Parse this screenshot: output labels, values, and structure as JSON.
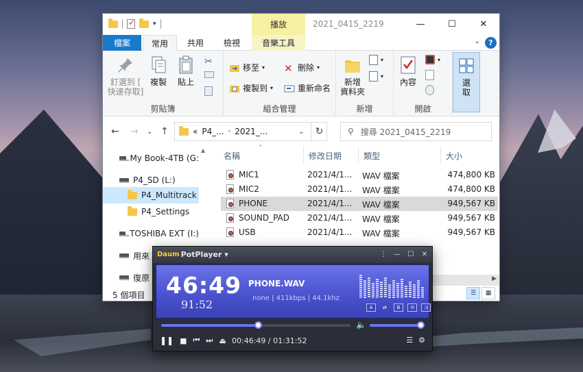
{
  "explorer": {
    "qat": {
      "dropdown_icon": "▾"
    },
    "contextual_tab": "播放",
    "title": "2021_0415_2219",
    "tabs": {
      "file": "檔案",
      "home": "常用",
      "share": "共用",
      "view": "檢視",
      "music": "音樂工具"
    },
    "ribbon": {
      "clipboard": {
        "label": "剪貼簿",
        "pin": "釘選到 [\n快速存取]",
        "copy": "複製",
        "paste": "貼上"
      },
      "organize": {
        "label": "組合管理",
        "move_to": "移至",
        "copy_to": "複製到",
        "delete": "刪除",
        "rename": "重新命名"
      },
      "new": {
        "label": "新增",
        "new_folder": "新增\n資料夾"
      },
      "open": {
        "label": "開啟",
        "properties": "內容"
      },
      "select": {
        "select": "選\n取"
      }
    },
    "address": {
      "prefix": "«",
      "part1": "P4_...",
      "part2": "2021_...",
      "search_placeholder": "搜尋 2021_0415_2219"
    },
    "nav": [
      {
        "label": "My Book-4TB (G:",
        "type": "drive"
      },
      {
        "label": "P4_SD (L:)",
        "type": "drive"
      },
      {
        "label": "P4_Multitrack",
        "type": "folder",
        "selected": true
      },
      {
        "label": "P4_Settings",
        "type": "folder"
      },
      {
        "label": "TOSHIBA EXT (I:)",
        "type": "drive"
      },
      {
        "label": "用來",
        "type": "drive"
      },
      {
        "label": "復原",
        "type": "drive"
      }
    ],
    "columns": {
      "name": "名稱",
      "date": "修改日期",
      "type": "類型",
      "size": "大小"
    },
    "files": [
      {
        "name": "MIC1",
        "date": "2021/4/1...",
        "type": "WAV 檔案",
        "size": "474,800 KB"
      },
      {
        "name": "MIC2",
        "date": "2021/4/1...",
        "type": "WAV 檔案",
        "size": "474,800 KB"
      },
      {
        "name": "PHONE",
        "date": "2021/4/1...",
        "type": "WAV 檔案",
        "size": "949,567 KB",
        "selected": true
      },
      {
        "name": "SOUND_PAD",
        "date": "2021/4/1...",
        "type": "WAV 檔案",
        "size": "949,567 KB"
      },
      {
        "name": "USB",
        "date": "2021/4/1...",
        "type": "WAV 檔案",
        "size": "949,567 KB"
      }
    ],
    "status": "5 個項目"
  },
  "player": {
    "brand": "Daum",
    "name": "PotPlayer ▾",
    "time_elapsed_big": "46:49",
    "time_total_small": "91:52",
    "filename": "PHONE.WAV",
    "info": "none | 411kbps | 44.1khz",
    "time_text": "00:46:49 / 01:31:52",
    "progress": 0.51,
    "volume": 1.0,
    "colors": {
      "screen": "#5a62de",
      "accent": "#7a82f0"
    }
  }
}
